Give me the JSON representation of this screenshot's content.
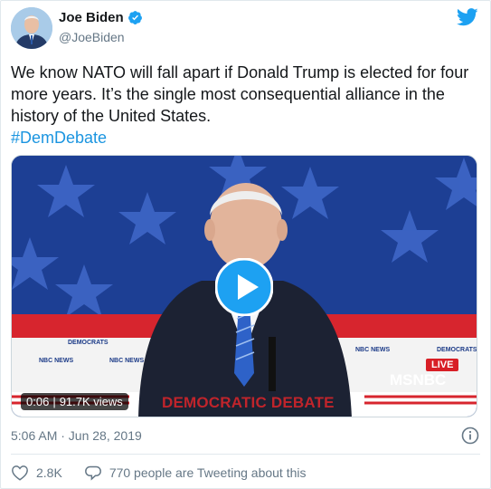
{
  "author": {
    "name": "Joe Biden",
    "handle": "@JoeBiden"
  },
  "tweet": {
    "text": "We know NATO will fall apart if Donald Trump is elected for four more years. It’s the single most consequential alliance in the history of the United States.",
    "hashtag": "#DemDebate"
  },
  "video": {
    "duration": "0:06",
    "views": "91.7K views",
    "banner": "DEMOCRATIC DEBATE",
    "live_label": "LIVE",
    "network": "MSNBC"
  },
  "timestamp": "5:06 AM · Jun 28, 2019",
  "actions": {
    "likes": "2.8K",
    "tweeting": "770 people are Tweeting about this"
  },
  "colors": {
    "link": "#1b95e0",
    "verified": "#1da1f2",
    "secondary_text": "#657786"
  }
}
